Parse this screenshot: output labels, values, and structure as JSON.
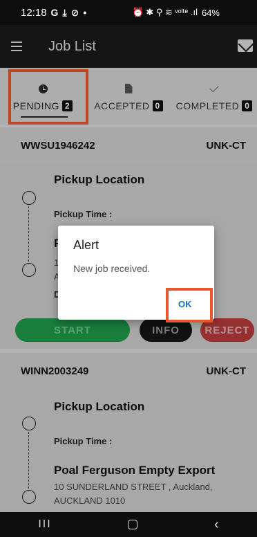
{
  "status_bar": {
    "time": "12:18",
    "left_icons": [
      "G",
      "⤓",
      "⊘",
      "•"
    ],
    "right_icons": "⏰ ✱ ⚲ ≋ ᵛᵒˡᵗᵉ .ıl",
    "battery": "64%"
  },
  "app_bar": {
    "title": "Job List"
  },
  "tabs": [
    {
      "label": "PENDING",
      "count": "2",
      "icon": "clock-icon"
    },
    {
      "label": "ACCEPTED",
      "count": "0",
      "icon": "document-icon"
    },
    {
      "label": "COMPLETED",
      "count": "0",
      "icon": "check-icon"
    }
  ],
  "jobs": [
    {
      "id": "WWSU1946242",
      "type": "UNK-CT",
      "pickup_title": "Pickup Location",
      "pickup_time_label": "Pickup Time :",
      "dropoff_initial": "P",
      "addr_initial_1": "1",
      "addr_initial_2": "A",
      "d_initial": "D",
      "buttons": {
        "start": "START",
        "info": "INFO",
        "reject": "REJECT"
      }
    },
    {
      "id": "WINN2003249",
      "type": "UNK-CT",
      "pickup_title": "Pickup Location",
      "pickup_time_label": "Pickup Time :",
      "dropoff_title": "Poal Ferguson Empty Export",
      "dropoff_address_1": "10 SUNDERLAND STREET , Auckland,",
      "dropoff_address_2": "AUCKLAND 1010"
    }
  ],
  "dialog": {
    "title": "Alert",
    "message": "New job received.",
    "ok_label": "OK"
  },
  "nav_bar": {
    "recents": "III",
    "back": "‹"
  },
  "colors": {
    "highlight": "#e8562c",
    "start": "#1f9a4a",
    "reject": "#b73a3a",
    "ok": "#1a6fc4"
  }
}
